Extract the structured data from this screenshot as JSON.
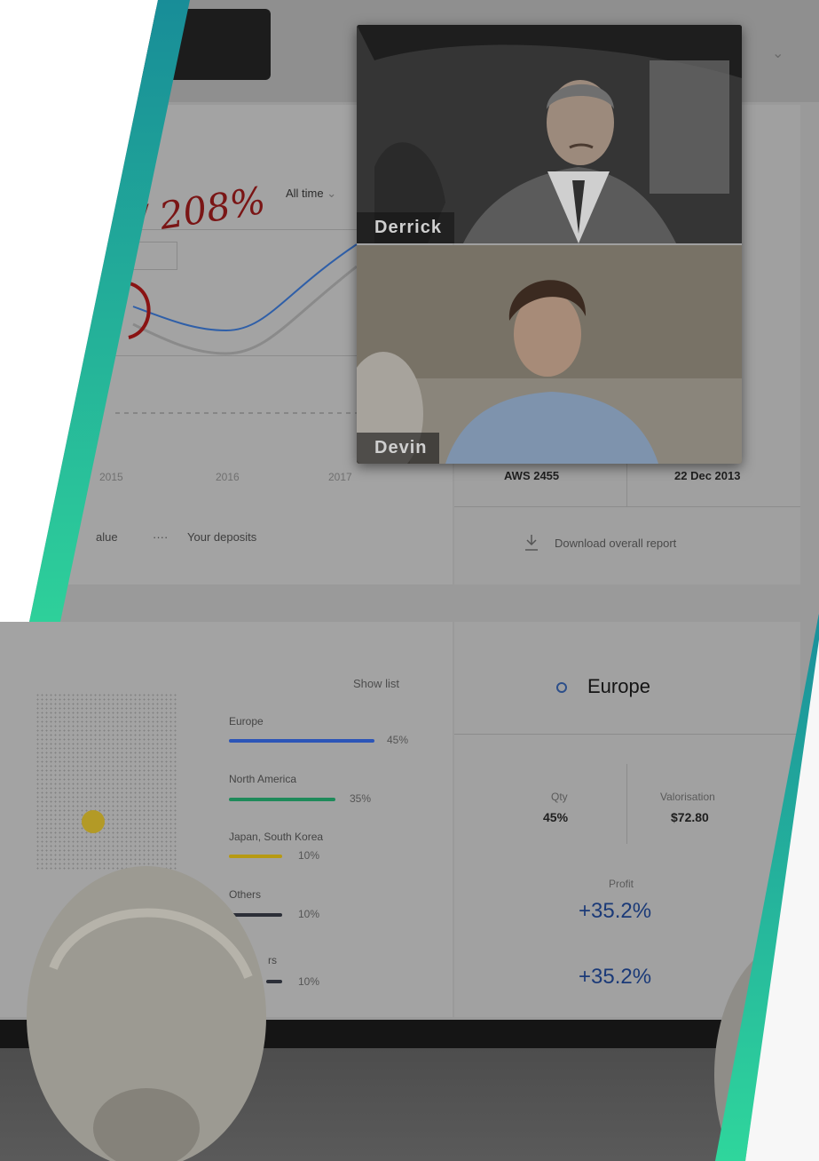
{
  "dashboard": {
    "growth_label": "208%",
    "time_filter": "All time",
    "years": [
      "2015",
      "2016",
      "2017"
    ],
    "legend": {
      "value_label": "alue",
      "dots": "····",
      "deposits_label": "Your deposits"
    },
    "table": {
      "code": "AWS 2455",
      "date": "22 Dec 2013"
    },
    "download_label": "Download overall report"
  },
  "regions": {
    "show_list_label": "Show list",
    "items": [
      {
        "label": "Europe",
        "pct": "45%",
        "color": "#2c55b8"
      },
      {
        "label": "North America",
        "pct": "35%",
        "color": "#1e8a5a"
      },
      {
        "label": "Japan, South Korea",
        "pct": "10%",
        "color": "#b79a12"
      },
      {
        "label": "Others",
        "pct": "10%",
        "color": "#2c2f38"
      },
      {
        "label": "rs",
        "pct": "10%",
        "color": "#2c2f38"
      }
    ]
  },
  "europe_panel": {
    "title": "Europe",
    "qty_label": "Qty",
    "qty_value": "45%",
    "valorisation_label": "Valorisation",
    "valorisation_value": "$72.80",
    "profit_label": "Profit",
    "profit_value": "+35.2%",
    "profit_value_2": "+35.2%"
  },
  "video_call": {
    "participants": [
      "Derrick",
      "Devin"
    ]
  },
  "colors": {
    "accent_teal_top": "#1b8f99",
    "accent_teal_bottom": "#2cd39a",
    "growth_red": "#8a1313"
  }
}
